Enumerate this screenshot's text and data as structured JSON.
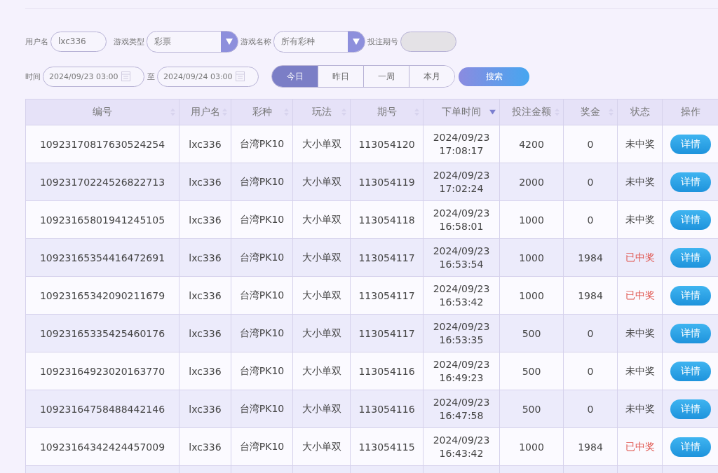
{
  "filters": {
    "username": {
      "label": "用户名",
      "value": "lxc336"
    },
    "game_type": {
      "label": "游戏类型",
      "value": "彩票"
    },
    "game_name": {
      "label": "游戏名称",
      "value": "所有彩种"
    },
    "issue": {
      "label": "投注期号",
      "disabled": true
    },
    "time": {
      "label": "时间",
      "from": "2024/09/23 03:00",
      "separator": "至",
      "to": "2024/09/24 03:00"
    },
    "ranges": [
      {
        "label": "今日",
        "selected": true
      },
      {
        "label": "昨日",
        "selected": false
      },
      {
        "label": "一周",
        "selected": false
      },
      {
        "label": "本月",
        "selected": false
      }
    ],
    "search_button": "搜索"
  },
  "table": {
    "columns": [
      {
        "label": "编号",
        "sortable": true
      },
      {
        "label": "用户名",
        "sortable": true
      },
      {
        "label": "彩种",
        "sortable": true
      },
      {
        "label": "玩法",
        "sortable": true
      },
      {
        "label": "期号",
        "sortable": true
      },
      {
        "label": "下单时间",
        "sortable": true,
        "sorted": true
      },
      {
        "label": "投注金额",
        "sortable": true
      },
      {
        "label": "奖金",
        "sortable": true
      },
      {
        "label": "状态",
        "sortable": false
      },
      {
        "label": "操作",
        "sortable": false
      }
    ],
    "rows": [
      {
        "id": "10923170817630524254",
        "user": "lxc336",
        "lottery": "台湾PK10",
        "play": "大小单双",
        "issue": "113054120",
        "date": "2024/09/23",
        "time": "17:08:17",
        "amount": "4200",
        "prize": "0",
        "status": "未中奖",
        "won": false,
        "action": "详情"
      },
      {
        "id": "10923170224526822713",
        "user": "lxc336",
        "lottery": "台湾PK10",
        "play": "大小单双",
        "issue": "113054119",
        "date": "2024/09/23",
        "time": "17:02:24",
        "amount": "2000",
        "prize": "0",
        "status": "未中奖",
        "won": false,
        "action": "详情"
      },
      {
        "id": "10923165801941245105",
        "user": "lxc336",
        "lottery": "台湾PK10",
        "play": "大小单双",
        "issue": "113054118",
        "date": "2024/09/23",
        "time": "16:58:01",
        "amount": "1000",
        "prize": "0",
        "status": "未中奖",
        "won": false,
        "action": "详情"
      },
      {
        "id": "10923165354416472691",
        "user": "lxc336",
        "lottery": "台湾PK10",
        "play": "大小单双",
        "issue": "113054117",
        "date": "2024/09/23",
        "time": "16:53:54",
        "amount": "1000",
        "prize": "1984",
        "status": "已中奖",
        "won": true,
        "action": "详情"
      },
      {
        "id": "10923165342090211679",
        "user": "lxc336",
        "lottery": "台湾PK10",
        "play": "大小单双",
        "issue": "113054117",
        "date": "2024/09/23",
        "time": "16:53:42",
        "amount": "1000",
        "prize": "1984",
        "status": "已中奖",
        "won": true,
        "action": "详情"
      },
      {
        "id": "10923165335425460176",
        "user": "lxc336",
        "lottery": "台湾PK10",
        "play": "大小单双",
        "issue": "113054117",
        "date": "2024/09/23",
        "time": "16:53:35",
        "amount": "500",
        "prize": "0",
        "status": "未中奖",
        "won": false,
        "action": "详情"
      },
      {
        "id": "10923164923020163770",
        "user": "lxc336",
        "lottery": "台湾PK10",
        "play": "大小单双",
        "issue": "113054116",
        "date": "2024/09/23",
        "time": "16:49:23",
        "amount": "500",
        "prize": "0",
        "status": "未中奖",
        "won": false,
        "action": "详情"
      },
      {
        "id": "10923164758488442146",
        "user": "lxc336",
        "lottery": "台湾PK10",
        "play": "大小单双",
        "issue": "113054116",
        "date": "2024/09/23",
        "time": "16:47:58",
        "amount": "500",
        "prize": "0",
        "status": "未中奖",
        "won": false,
        "action": "详情"
      },
      {
        "id": "10923164342424457009",
        "user": "lxc336",
        "lottery": "台湾PK10",
        "play": "大小单双",
        "issue": "113054115",
        "date": "2024/09/23",
        "time": "16:43:42",
        "amount": "1000",
        "prize": "1984",
        "status": "已中奖",
        "won": true,
        "action": "详情"
      }
    ]
  }
}
